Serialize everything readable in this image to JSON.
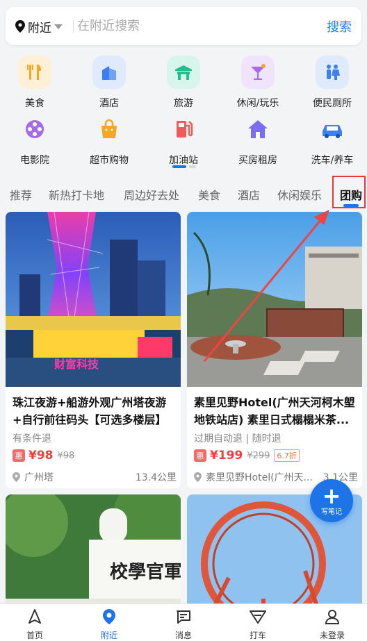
{
  "search": {
    "location_label": "附近",
    "placeholder": "在附近搜索",
    "button_label": "搜索"
  },
  "categories": [
    {
      "label": "美食",
      "icon": "food-icon",
      "color": "#f5a623"
    },
    {
      "label": "酒店",
      "icon": "hotel-icon",
      "color": "#3b7ff0"
    },
    {
      "label": "旅游",
      "icon": "travel-icon",
      "color": "#1fbf8f"
    },
    {
      "label": "休闲/玩乐",
      "icon": "leisure-icon",
      "color": "#a66be8"
    },
    {
      "label": "便民厕所",
      "icon": "toilet-icon",
      "color": "#3b7ff0"
    },
    {
      "label": "电影院",
      "icon": "cinema-icon",
      "color": "#a66be8"
    },
    {
      "label": "超市购物",
      "icon": "shopping-icon",
      "color": "#f5a623"
    },
    {
      "label": "加油站",
      "icon": "gas-station-icon",
      "color": "#f05a5a"
    },
    {
      "label": "买房租房",
      "icon": "house-icon",
      "color": "#7b6cf0"
    },
    {
      "label": "洗车/养车",
      "icon": "car-wash-icon",
      "color": "#3b7ff0"
    }
  ],
  "tabs": [
    "推荐",
    "新热打卡地",
    "周边好去处",
    "美食",
    "酒店",
    "休闲娱乐",
    "团购"
  ],
  "active_tab": "团购",
  "cards": [
    {
      "title": "珠江夜游+船游外观广州塔夜游+自行前往码头【可选多楼层】",
      "meta": "有条件退",
      "badge": "惠",
      "price": "¥98",
      "old_price": "¥98",
      "discount": "",
      "location": "广州塔",
      "distance": "13.4公里",
      "image_text": "财富科技"
    },
    {
      "title": "素里见野Hotel(广州天河柯木塱地铁站店) 素里日式榻榻米茶...",
      "meta": "过期自动退 | 随时退",
      "badge": "惠",
      "price": "¥199",
      "old_price": "¥299",
      "discount": "6.7折",
      "location": "素里见野Hotel(广州天...",
      "distance": "3.1公里"
    },
    {
      "image_text": "校學官軍"
    },
    {}
  ],
  "fab": {
    "label": "写笔记"
  },
  "bottom_nav": [
    {
      "label": "首页",
      "icon": "home-icon"
    },
    {
      "label": "附近",
      "icon": "nearby-icon"
    },
    {
      "label": "消息",
      "icon": "message-icon"
    },
    {
      "label": "打车",
      "icon": "taxi-icon"
    },
    {
      "label": "未登录",
      "icon": "profile-icon"
    }
  ],
  "colors": {
    "accent": "#1e73e8",
    "price": "#ef3f3f",
    "highlight_box": "#e63a3a"
  }
}
